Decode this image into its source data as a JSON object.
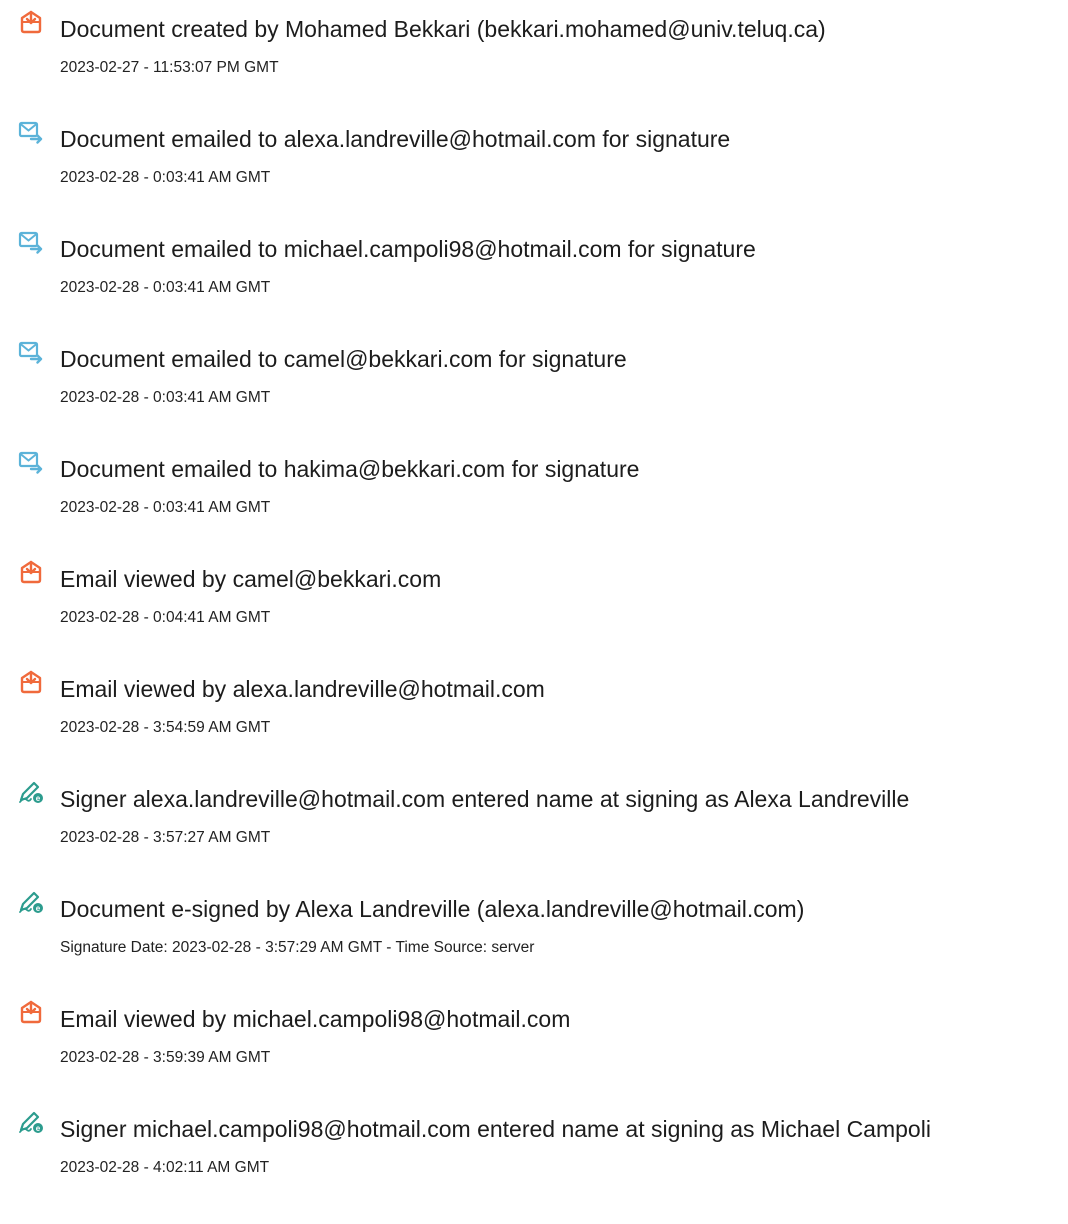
{
  "colors": {
    "document_icon": "#F06A3C",
    "email_icon": "#5BB3D9",
    "signature_icon": "#2C9C8E",
    "text": "#1C1C1C"
  },
  "events": [
    {
      "icon": "document-icon",
      "title": "Document created by Mohamed Bekkari (bekkari.mohamed@univ.teluq.ca)",
      "timestamp": "2023-02-27 - 11:53:07 PM GMT"
    },
    {
      "icon": "email-sent-icon",
      "title": "Document emailed to alexa.landreville@hotmail.com for signature",
      "timestamp": "2023-02-28 - 0:03:41 AM GMT"
    },
    {
      "icon": "email-sent-icon",
      "title": "Document emailed to michael.campoli98@hotmail.com for signature",
      "timestamp": "2023-02-28 - 0:03:41 AM GMT"
    },
    {
      "icon": "email-sent-icon",
      "title": "Document emailed to camel@bekkari.com for signature",
      "timestamp": "2023-02-28 - 0:03:41 AM GMT"
    },
    {
      "icon": "email-sent-icon",
      "title": "Document emailed to hakima@bekkari.com for signature",
      "timestamp": "2023-02-28 - 0:03:41 AM GMT"
    },
    {
      "icon": "document-icon",
      "title": "Email viewed by camel@bekkari.com",
      "timestamp": "2023-02-28 - 0:04:41 AM GMT"
    },
    {
      "icon": "document-icon",
      "title": "Email viewed by alexa.landreville@hotmail.com",
      "timestamp": "2023-02-28 - 3:54:59 AM GMT"
    },
    {
      "icon": "signature-icon",
      "title": "Signer alexa.landreville@hotmail.com entered name at signing as Alexa Landreville",
      "timestamp": "2023-02-28 - 3:57:27 AM GMT"
    },
    {
      "icon": "signature-icon",
      "title": "Document e-signed by Alexa Landreville (alexa.landreville@hotmail.com)",
      "timestamp": "Signature Date: 2023-02-28 - 3:57:29 AM GMT - Time Source: server"
    },
    {
      "icon": "document-icon",
      "title": "Email viewed by michael.campoli98@hotmail.com",
      "timestamp": "2023-02-28 - 3:59:39 AM GMT"
    },
    {
      "icon": "signature-icon",
      "title": "Signer michael.campoli98@hotmail.com entered name at signing as Michael Campoli",
      "timestamp": "2023-02-28 - 4:02:11 AM GMT"
    }
  ]
}
